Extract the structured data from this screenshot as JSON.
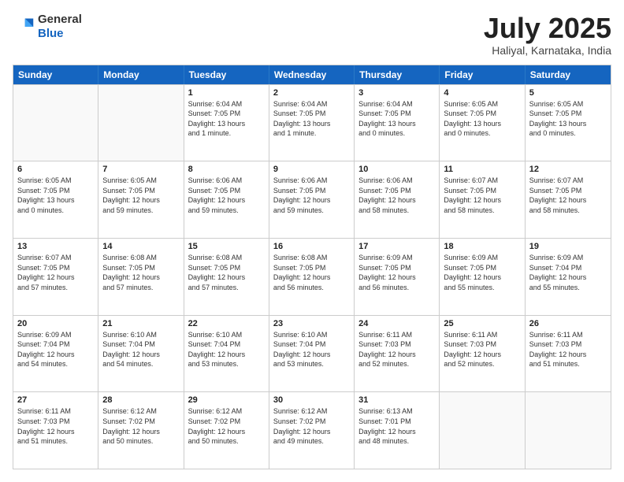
{
  "header": {
    "logo_general": "General",
    "logo_blue": "Blue",
    "month_title": "July 2025",
    "location": "Haliyal, Karnataka, India"
  },
  "calendar": {
    "weekdays": [
      "Sunday",
      "Monday",
      "Tuesday",
      "Wednesday",
      "Thursday",
      "Friday",
      "Saturday"
    ],
    "rows": [
      [
        {
          "day": "",
          "empty": true
        },
        {
          "day": "",
          "empty": true
        },
        {
          "day": "1",
          "info": "Sunrise: 6:04 AM\nSunset: 7:05 PM\nDaylight: 13 hours\nand 1 minute."
        },
        {
          "day": "2",
          "info": "Sunrise: 6:04 AM\nSunset: 7:05 PM\nDaylight: 13 hours\nand 1 minute."
        },
        {
          "day": "3",
          "info": "Sunrise: 6:04 AM\nSunset: 7:05 PM\nDaylight: 13 hours\nand 0 minutes."
        },
        {
          "day": "4",
          "info": "Sunrise: 6:05 AM\nSunset: 7:05 PM\nDaylight: 13 hours\nand 0 minutes."
        },
        {
          "day": "5",
          "info": "Sunrise: 6:05 AM\nSunset: 7:05 PM\nDaylight: 13 hours\nand 0 minutes."
        }
      ],
      [
        {
          "day": "6",
          "info": "Sunrise: 6:05 AM\nSunset: 7:05 PM\nDaylight: 13 hours\nand 0 minutes."
        },
        {
          "day": "7",
          "info": "Sunrise: 6:05 AM\nSunset: 7:05 PM\nDaylight: 12 hours\nand 59 minutes."
        },
        {
          "day": "8",
          "info": "Sunrise: 6:06 AM\nSunset: 7:05 PM\nDaylight: 12 hours\nand 59 minutes."
        },
        {
          "day": "9",
          "info": "Sunrise: 6:06 AM\nSunset: 7:05 PM\nDaylight: 12 hours\nand 59 minutes."
        },
        {
          "day": "10",
          "info": "Sunrise: 6:06 AM\nSunset: 7:05 PM\nDaylight: 12 hours\nand 58 minutes."
        },
        {
          "day": "11",
          "info": "Sunrise: 6:07 AM\nSunset: 7:05 PM\nDaylight: 12 hours\nand 58 minutes."
        },
        {
          "day": "12",
          "info": "Sunrise: 6:07 AM\nSunset: 7:05 PM\nDaylight: 12 hours\nand 58 minutes."
        }
      ],
      [
        {
          "day": "13",
          "info": "Sunrise: 6:07 AM\nSunset: 7:05 PM\nDaylight: 12 hours\nand 57 minutes."
        },
        {
          "day": "14",
          "info": "Sunrise: 6:08 AM\nSunset: 7:05 PM\nDaylight: 12 hours\nand 57 minutes."
        },
        {
          "day": "15",
          "info": "Sunrise: 6:08 AM\nSunset: 7:05 PM\nDaylight: 12 hours\nand 57 minutes."
        },
        {
          "day": "16",
          "info": "Sunrise: 6:08 AM\nSunset: 7:05 PM\nDaylight: 12 hours\nand 56 minutes."
        },
        {
          "day": "17",
          "info": "Sunrise: 6:09 AM\nSunset: 7:05 PM\nDaylight: 12 hours\nand 56 minutes."
        },
        {
          "day": "18",
          "info": "Sunrise: 6:09 AM\nSunset: 7:05 PM\nDaylight: 12 hours\nand 55 minutes."
        },
        {
          "day": "19",
          "info": "Sunrise: 6:09 AM\nSunset: 7:04 PM\nDaylight: 12 hours\nand 55 minutes."
        }
      ],
      [
        {
          "day": "20",
          "info": "Sunrise: 6:09 AM\nSunset: 7:04 PM\nDaylight: 12 hours\nand 54 minutes."
        },
        {
          "day": "21",
          "info": "Sunrise: 6:10 AM\nSunset: 7:04 PM\nDaylight: 12 hours\nand 54 minutes."
        },
        {
          "day": "22",
          "info": "Sunrise: 6:10 AM\nSunset: 7:04 PM\nDaylight: 12 hours\nand 53 minutes."
        },
        {
          "day": "23",
          "info": "Sunrise: 6:10 AM\nSunset: 7:04 PM\nDaylight: 12 hours\nand 53 minutes."
        },
        {
          "day": "24",
          "info": "Sunrise: 6:11 AM\nSunset: 7:03 PM\nDaylight: 12 hours\nand 52 minutes."
        },
        {
          "day": "25",
          "info": "Sunrise: 6:11 AM\nSunset: 7:03 PM\nDaylight: 12 hours\nand 52 minutes."
        },
        {
          "day": "26",
          "info": "Sunrise: 6:11 AM\nSunset: 7:03 PM\nDaylight: 12 hours\nand 51 minutes."
        }
      ],
      [
        {
          "day": "27",
          "info": "Sunrise: 6:11 AM\nSunset: 7:03 PM\nDaylight: 12 hours\nand 51 minutes."
        },
        {
          "day": "28",
          "info": "Sunrise: 6:12 AM\nSunset: 7:02 PM\nDaylight: 12 hours\nand 50 minutes."
        },
        {
          "day": "29",
          "info": "Sunrise: 6:12 AM\nSunset: 7:02 PM\nDaylight: 12 hours\nand 50 minutes."
        },
        {
          "day": "30",
          "info": "Sunrise: 6:12 AM\nSunset: 7:02 PM\nDaylight: 12 hours\nand 49 minutes."
        },
        {
          "day": "31",
          "info": "Sunrise: 6:13 AM\nSunset: 7:01 PM\nDaylight: 12 hours\nand 48 minutes."
        },
        {
          "day": "",
          "empty": true
        },
        {
          "day": "",
          "empty": true
        }
      ]
    ]
  }
}
